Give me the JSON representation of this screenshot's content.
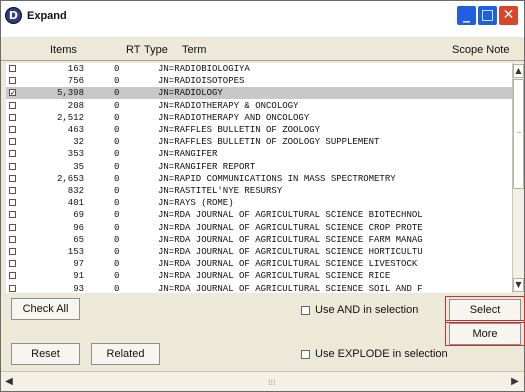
{
  "window": {
    "title": "Expand",
    "app_icon": "app-logo-icon"
  },
  "header": {
    "items": "Items",
    "rt": "RT",
    "type": "Type",
    "term": "Term",
    "scope_note": "Scope Note"
  },
  "rows": [
    {
      "checked": "",
      "items": "163",
      "rt": "0",
      "term": "JN=RADIOBIOLOGIYA",
      "selected": false
    },
    {
      "checked": "",
      "items": "756",
      "rt": "0",
      "term": "JN=RADIOISOTOPES",
      "selected": false
    },
    {
      "checked": "✓",
      "items": "5,398",
      "rt": "0",
      "term": "JN=RADIOLOGY",
      "selected": true
    },
    {
      "checked": "",
      "items": "208",
      "rt": "0",
      "term": "JN=RADIOTHERAPY & ONCOLOGY",
      "selected": false
    },
    {
      "checked": "",
      "items": "2,512",
      "rt": "0",
      "term": "JN=RADIOTHERAPY AND ONCOLOGY",
      "selected": false
    },
    {
      "checked": "",
      "items": "463",
      "rt": "0",
      "term": "JN=RAFFLES BULLETIN OF ZOOLOGY",
      "selected": false
    },
    {
      "checked": "",
      "items": "32",
      "rt": "0",
      "term": "JN=RAFFLES BULLETIN OF ZOOLOGY SUPPLEMENT",
      "selected": false
    },
    {
      "checked": "",
      "items": "353",
      "rt": "0",
      "term": "JN=RANGIFER",
      "selected": false
    },
    {
      "checked": "",
      "items": "35",
      "rt": "0",
      "term": "JN=RANGIFER REPORT",
      "selected": false
    },
    {
      "checked": "",
      "items": "2,653",
      "rt": "0",
      "term": "JN=RAPID COMMUNICATIONS IN MASS SPECTROMETRY",
      "selected": false
    },
    {
      "checked": "",
      "items": "832",
      "rt": "0",
      "term": "JN=RASTITEL'NYE RESURSY",
      "selected": false
    },
    {
      "checked": "",
      "items": "401",
      "rt": "0",
      "term": "JN=RAYS (ROME)",
      "selected": false
    },
    {
      "checked": "",
      "items": "69",
      "rt": "0",
      "term": "JN=RDA JOURNAL OF AGRICULTURAL SCIENCE BIOTECHNOL",
      "selected": false
    },
    {
      "checked": "",
      "items": "96",
      "rt": "0",
      "term": "JN=RDA JOURNAL OF AGRICULTURAL SCIENCE CROP PROTE",
      "selected": false
    },
    {
      "checked": "",
      "items": "65",
      "rt": "0",
      "term": "JN=RDA JOURNAL OF AGRICULTURAL SCIENCE FARM MANAG",
      "selected": false
    },
    {
      "checked": "",
      "items": "153",
      "rt": "0",
      "term": "JN=RDA JOURNAL OF AGRICULTURAL SCIENCE HORTICULTU",
      "selected": false
    },
    {
      "checked": "",
      "items": "97",
      "rt": "0",
      "term": "JN=RDA JOURNAL OF AGRICULTURAL SCIENCE LIVESTOCK",
      "selected": false
    },
    {
      "checked": "",
      "items": "91",
      "rt": "0",
      "term": "JN=RDA JOURNAL OF AGRICULTURAL SCIENCE RICE",
      "selected": false
    },
    {
      "checked": "",
      "items": "93",
      "rt": "0",
      "term": "JN=RDA JOURNAL OF AGRICULTURAL SCIENCE SOIL AND F",
      "selected": false
    }
  ],
  "buttons": {
    "check_all": "Check All",
    "reset": "Reset",
    "related": "Related",
    "select": "Select",
    "more": "More"
  },
  "options": {
    "use_and": "Use AND in selection",
    "use_explode": "Use EXPLODE in selection"
  },
  "scrollbar": {
    "up": "▲",
    "down": "▼",
    "left": "◀",
    "right": "▶",
    "grip": "⁞⁞⁞"
  },
  "colors": {
    "selection_bg": "#c8c8c8",
    "highlight_border": "#d32f2f",
    "title_btn_blue": "#1f5fe0",
    "close_btn_red": "#d8462a"
  }
}
